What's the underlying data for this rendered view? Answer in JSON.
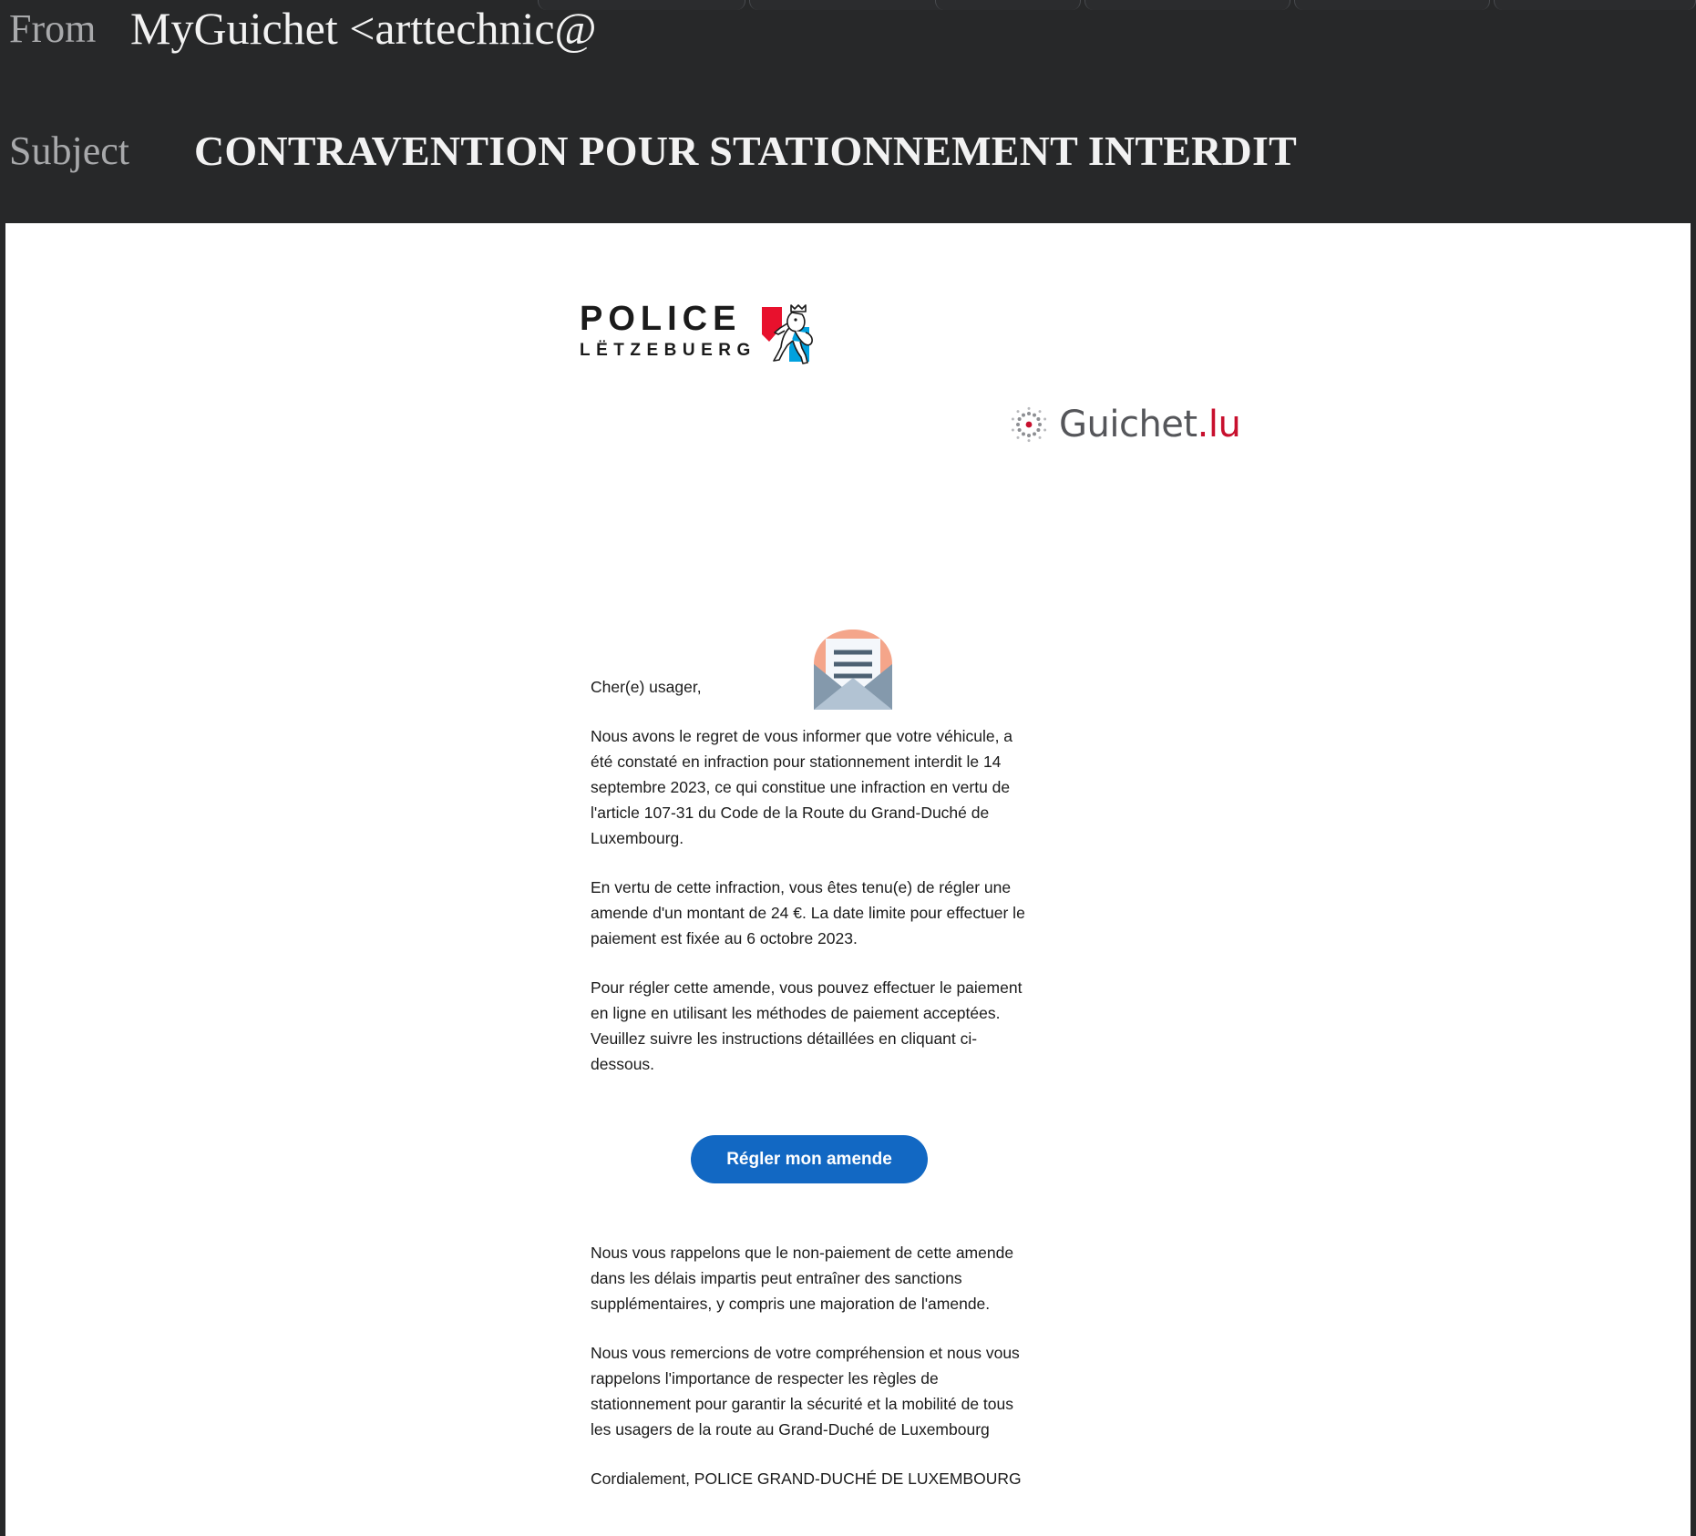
{
  "window": {
    "browser_tabs_visible": true
  },
  "mail_header": {
    "from_label": "From",
    "from_value": "MyGuichet <arttechnic@",
    "subject_label": "Subject",
    "subject_value": "CONTRAVENTION POUR STATIONNEMENT INTERDIT",
    "background_color": "#272829",
    "label_color": "#a8a9ab",
    "value_color": "#f2f2f2"
  },
  "email": {
    "police_logo": {
      "primary_text": "POLICE",
      "secondary_text": "LËTZEBUERG",
      "emblem_colors": {
        "red": "#e8112d",
        "blue": "#00a1de",
        "ink": "#1b1b1b"
      }
    },
    "guichet_logo": {
      "name": "Guichet",
      "tld": ".lu",
      "text_color": "#55565a",
      "accent_color": "#c8102e"
    },
    "envelope_icon": {
      "flap_color": "#f4a58a",
      "body_color": "#9bb0c4",
      "body_light_color": "#b6c6d6",
      "paper_color": "#f4f7fb",
      "line_color": "#4d6173"
    },
    "greeting": "Cher(e) usager,",
    "paragraphs": [
      "Nous avons le regret de vous informer que votre véhicule, a été constaté en infraction pour stationnement interdit le 14 septembre 2023, ce qui constitue une infraction en vertu de l'article 107-31 du Code de la Route du Grand-Duché de Luxembourg.",
      "En vertu de cette infraction, vous êtes tenu(e) de régler une amende d'un montant de 24 €. La date limite pour effectuer le paiement est fixée au 6 octobre 2023.",
      "Pour régler cette amende, vous pouvez effectuer le paiement en ligne en utilisant les méthodes de paiement acceptées. Veuillez suivre les instructions détaillées en cliquant ci-dessous."
    ],
    "cta": {
      "label": "Régler mon amende",
      "background_color": "#1268c3",
      "text_color": "#ffffff"
    },
    "paragraphs_after": [
      "Nous vous rappelons que le non-paiement de cette amende dans les délais impartis peut entraîner des sanctions supplémentaires, y compris une majoration de l'amende.",
      "Nous vous remercions de votre compréhension et nous vous rappelons l'importance de respecter les règles de stationnement pour garantir la sécurité et la mobilité de tous les usagers de la route au Grand-Duché de Luxembourg"
    ],
    "signoff": "Cordialement, POLICE GRAND-DUCHÉ DE LUXEMBOURG"
  }
}
